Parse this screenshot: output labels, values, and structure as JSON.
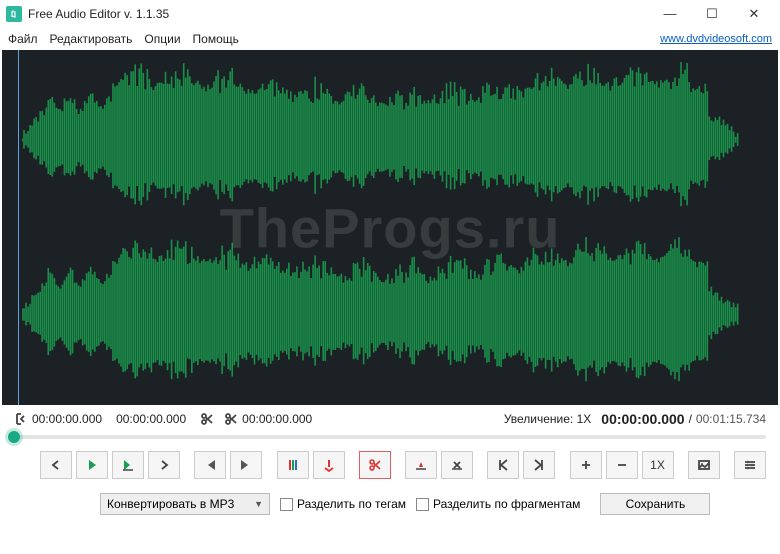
{
  "titlebar": {
    "title": "Free Audio Editor v. 1.1.35"
  },
  "menu": {
    "file": "Файл",
    "edit": "Редактировать",
    "options": "Опции",
    "help": "Помощь",
    "link": "www.dvdvideosoft.com"
  },
  "watermark": "TheProgs.ru",
  "info": {
    "sel_start": "00:00:00.000",
    "sel_end": "00:00:00.000",
    "cut_time": "00:00:00.000",
    "zoom_label": "Увеличение:",
    "zoom_value": "1X",
    "position": "00:00:00.000",
    "slash": "/",
    "total": "00:01:15.734"
  },
  "toolbar": {
    "speed": "1X"
  },
  "bottom": {
    "convert": "Конвертировать в MP3",
    "split_tags": "Разделить по тегам",
    "split_fragments": "Разделить по фрагментам",
    "save": "Сохранить"
  }
}
